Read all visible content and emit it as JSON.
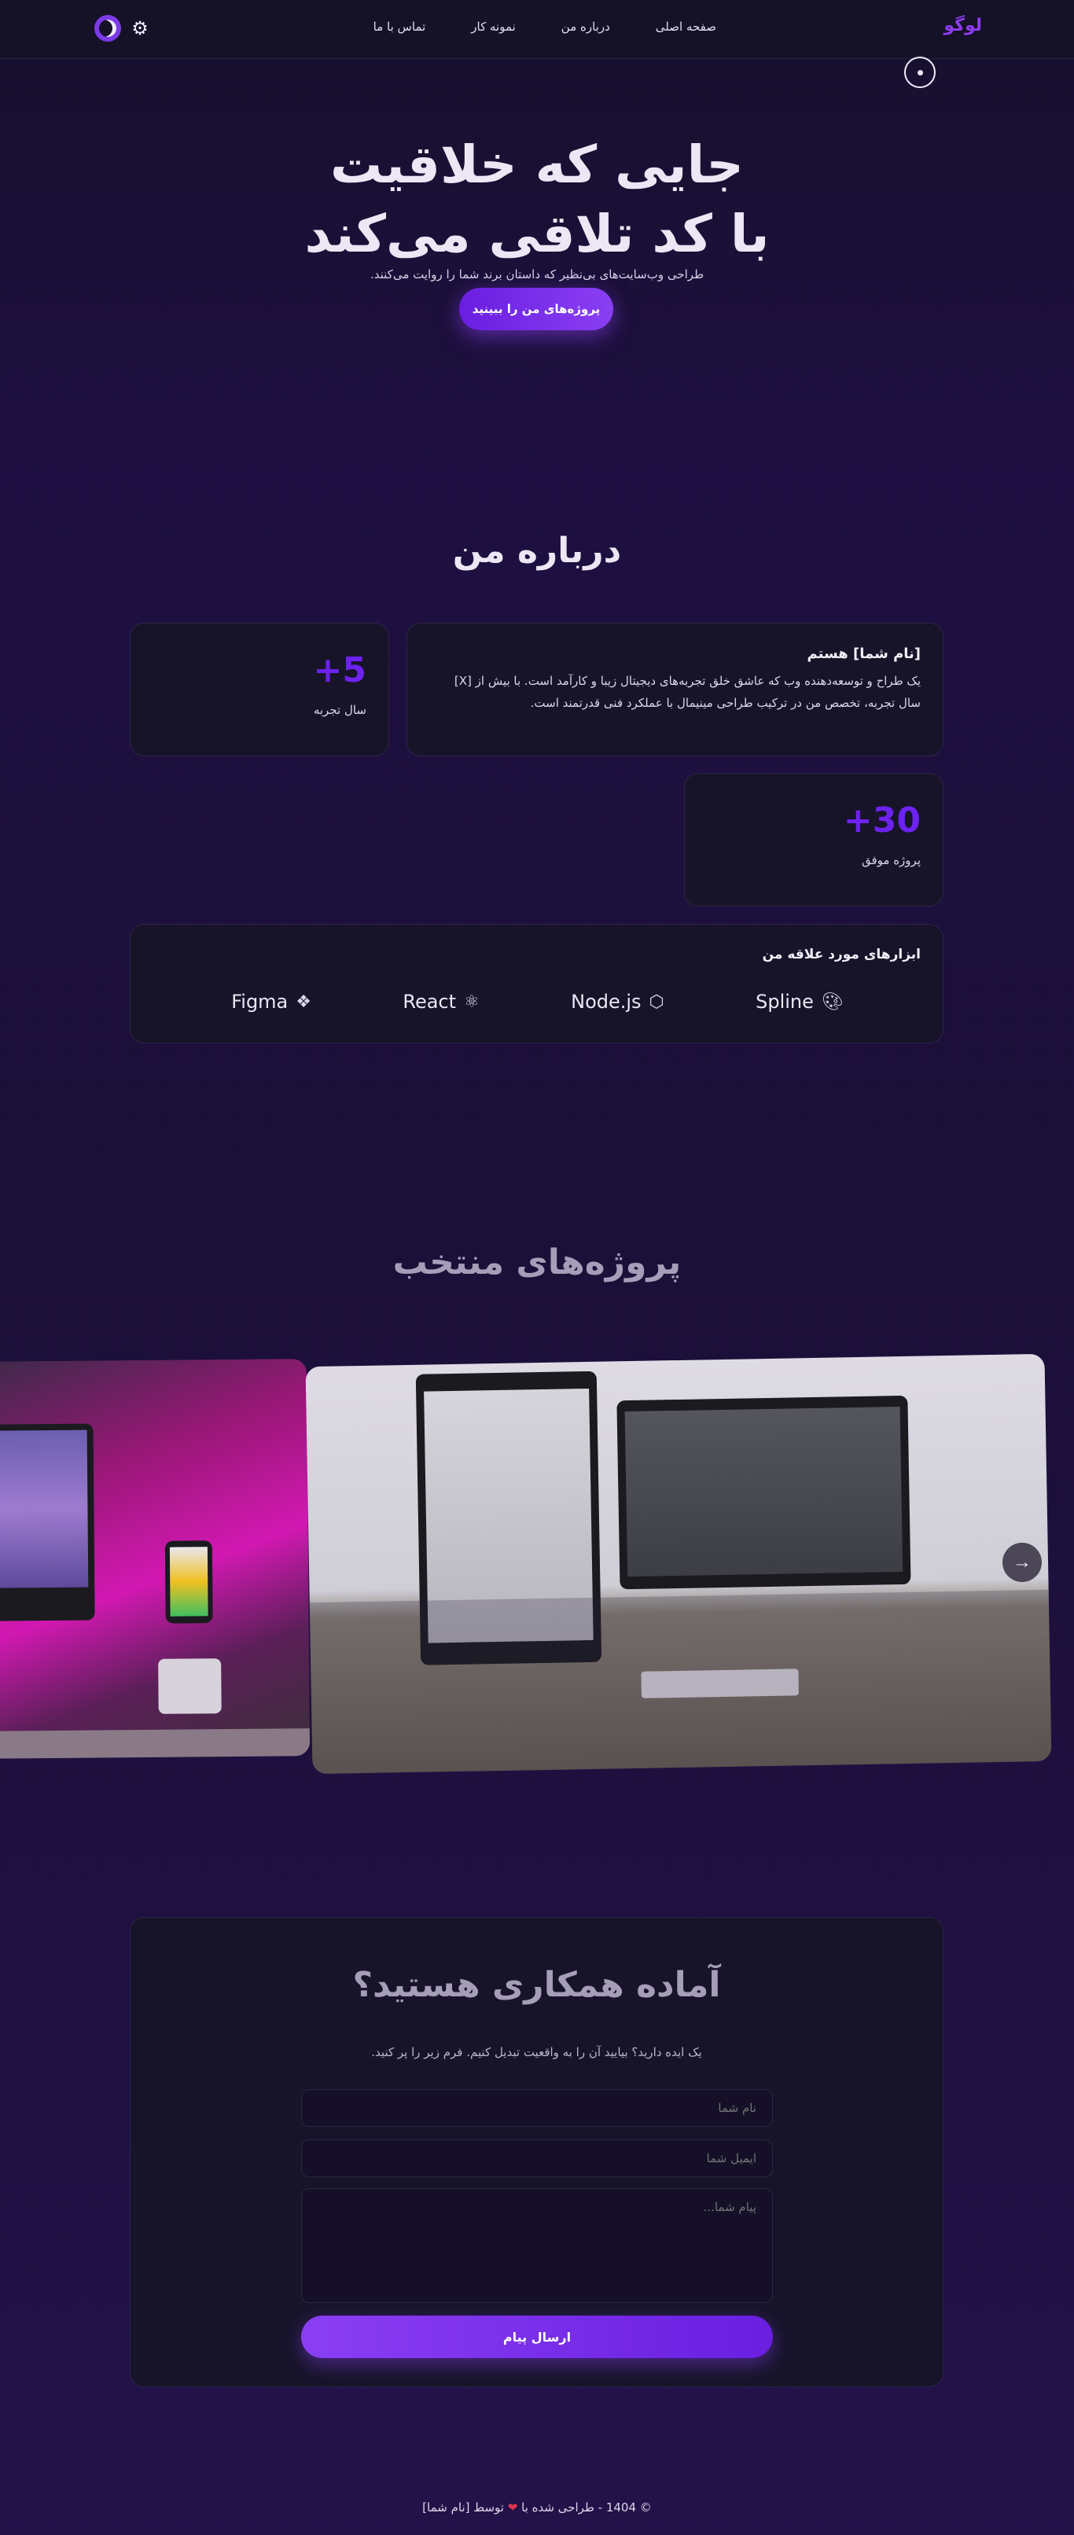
{
  "nav": {
    "logo": "لوگو",
    "links": [
      "صفحه اصلی",
      "درباره من",
      "نمونه کار",
      "تماس با ما"
    ],
    "theme_toggle": {
      "moon_icon": "moon-icon",
      "sun_icon": "gear-sun-icon"
    }
  },
  "hero": {
    "title_line1": "جایی که خلاقیت",
    "title_line2": "با کد تلاقی می‌کند",
    "subtitle": "طراحی وب‌سایت‌های بی‌نظیر که داستان برند شما را روایت می‌کنند.",
    "button": "پروژه‌های من را ببینید"
  },
  "about": {
    "title": "درباره من",
    "name": "[نام شما] هستم",
    "description": "یک طراح و توسعه‌دهنده وب که عاشق خلق تجربه‌های دیجیتال زیبا و کارآمد است. با بیش از [X] سال تجربه، تخصص من در ترکیب طراحی مینیمال با عملکرد فنی قدرتمند است.",
    "stats": [
      {
        "value": "+5",
        "label": "سال تجربه"
      },
      {
        "value": "+30",
        "label": "پروژه موفق"
      }
    ],
    "tools_title": "ابزارهای مورد علاقه من",
    "tools": [
      {
        "name": "Figma",
        "icon": "figma-icon"
      },
      {
        "name": "React",
        "icon": "react-icon"
      },
      {
        "name": "Node.js",
        "icon": "nodejs-icon"
      },
      {
        "name": "Spline",
        "icon": "palette-icon"
      }
    ]
  },
  "projects": {
    "title": "پروژه‌های منتخب",
    "next_icon": "arrow-right-icon"
  },
  "contact": {
    "title": "آماده همکاری هستید؟",
    "subtitle": "یک ایده دارید؟ بیایید آن را به واقعیت تبدیل کنیم. فرم زیر را پر کنید.",
    "name_placeholder": "نام شما",
    "email_placeholder": "ایمیل شما",
    "message_placeholder": "پیام شما...",
    "button": "ارسال پیام"
  },
  "footer": {
    "prefix": "© 1404 - طراحی شده با",
    "suffix": "توسط [نام شما]"
  },
  "colors": {
    "accent": "#6d22f0",
    "accent_light": "#8a3ff3",
    "background": "#1e0f42",
    "card": "#17142a"
  }
}
